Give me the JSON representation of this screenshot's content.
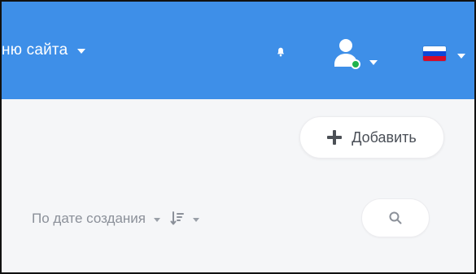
{
  "header": {
    "site_menu_label": "ню сайта",
    "background_color": "#3e8fe8",
    "status_color": "#1fb34d"
  },
  "toolbar": {
    "add_label": "Добавить"
  },
  "sort": {
    "label": "По дате создания"
  },
  "flag": {
    "colors": [
      "#ffffff",
      "#0d47d9",
      "#d60b28"
    ]
  },
  "icons": {
    "bell": "bell-icon",
    "user": "user-icon",
    "search": "search-icon",
    "sort": "sort-icon"
  }
}
